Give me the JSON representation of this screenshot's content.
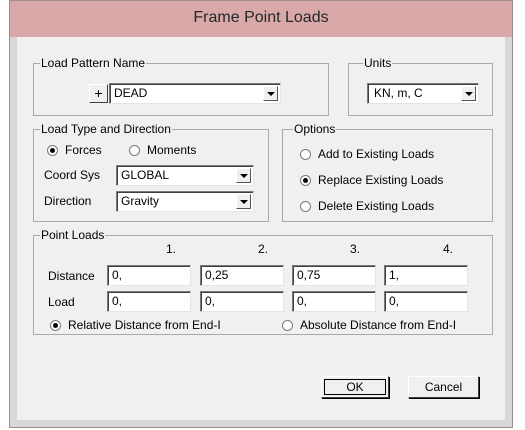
{
  "window": {
    "title": "Frame Point Loads"
  },
  "load_pattern": {
    "legend": "Load Pattern Name",
    "add_label": "+",
    "selected": "DEAD"
  },
  "units": {
    "legend": "Units",
    "selected": "KN, m, C"
  },
  "load_type": {
    "legend": "Load Type and Direction",
    "forces_label": "Forces",
    "moments_label": "Moments",
    "selected": "Forces",
    "coord_sys_label": "Coord Sys",
    "coord_sys_value": "GLOBAL",
    "direction_label": "Direction",
    "direction_value": "Gravity"
  },
  "options": {
    "legend": "Options",
    "add_label": "Add to Existing Loads",
    "replace_label": "Replace Existing Loads",
    "delete_label": "Delete Existing Loads",
    "selected": "Replace Existing Loads"
  },
  "point_loads": {
    "legend": "Point Loads",
    "columns": [
      "1.",
      "2.",
      "3.",
      "4."
    ],
    "distance_label": "Distance",
    "load_label": "Load",
    "distances": [
      "0,",
      "0,25",
      "0,75",
      "1,"
    ],
    "loads": [
      "0,",
      "0,",
      "0,",
      "0,"
    ],
    "relative_label": "Relative Distance from End-I",
    "absolute_label": "Absolute Distance from End-I",
    "selected": "Relative Distance from End-I"
  },
  "buttons": {
    "ok_label": "OK",
    "cancel_label": "Cancel"
  }
}
